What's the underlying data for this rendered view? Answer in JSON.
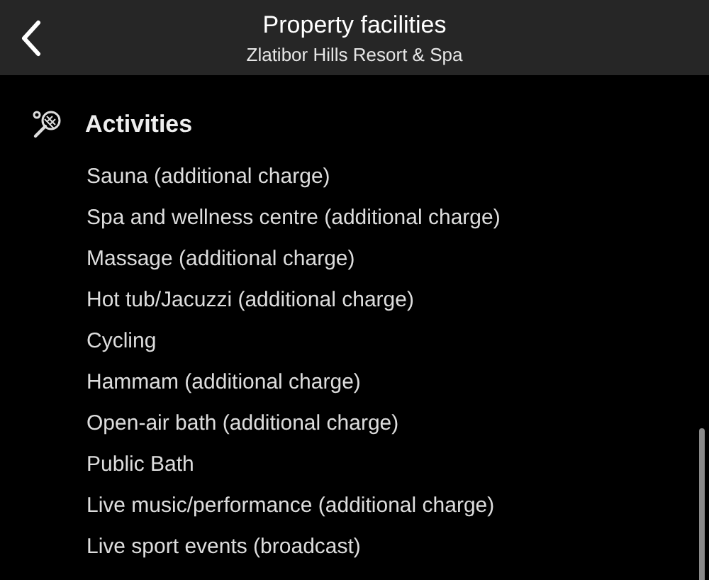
{
  "header": {
    "title": "Property facilities",
    "subtitle": "Zlatibor Hills Resort & Spa"
  },
  "section": {
    "title": "Activities",
    "items": [
      "Sauna (additional charge)",
      "Spa and wellness centre (additional charge)",
      "Massage (additional charge)",
      "Hot tub/Jacuzzi (additional charge)",
      "Cycling",
      "Hammam (additional charge)",
      "Open-air bath (additional charge)",
      "Public Bath",
      "Live music/performance (additional charge)",
      "Live sport events (broadcast)"
    ]
  }
}
